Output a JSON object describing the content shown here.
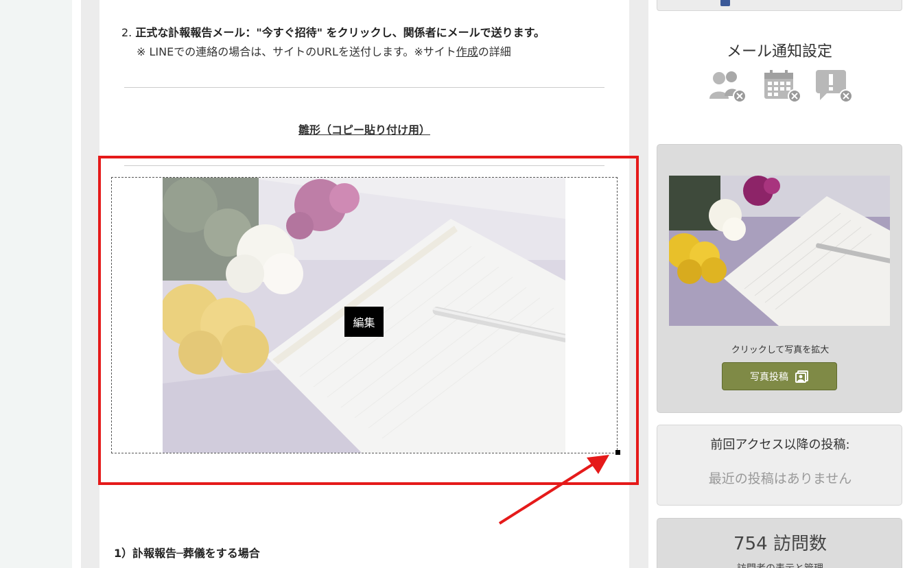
{
  "article": {
    "step_number": "2.",
    "step_text": "正式な訃報報告メール：\"今すぐ招待\" をクリックし、関係者にメールで送ります。",
    "note_prefix": "※ LINEでの連絡の場合は、サイトのURLを送付します。※サイト",
    "note_link": "作成",
    "note_suffix": "の詳細",
    "template_heading": "雛形（コピー貼り付け用）",
    "edit_label": "編集",
    "subheading": "1）訃報報告─葬儀をする場合"
  },
  "sidebar": {
    "mail_settings": {
      "title": "メール通知設定",
      "icons": [
        "members-off-icon",
        "calendar-off-icon",
        "alert-off-icon"
      ]
    },
    "photo": {
      "caption": "クリックして写真を拡大",
      "post_label": "写真投稿"
    },
    "recent": {
      "title": "前回アクセス以降の投稿:",
      "empty": "最近の投稿はありません"
    },
    "visits": {
      "count": "754 訪問数",
      "sub": "訪問者の表示と管理"
    }
  },
  "colors": {
    "highlight": "#e51a1a",
    "post_button": "#7f8a46",
    "icon_gray": "#b8b8b8"
  }
}
